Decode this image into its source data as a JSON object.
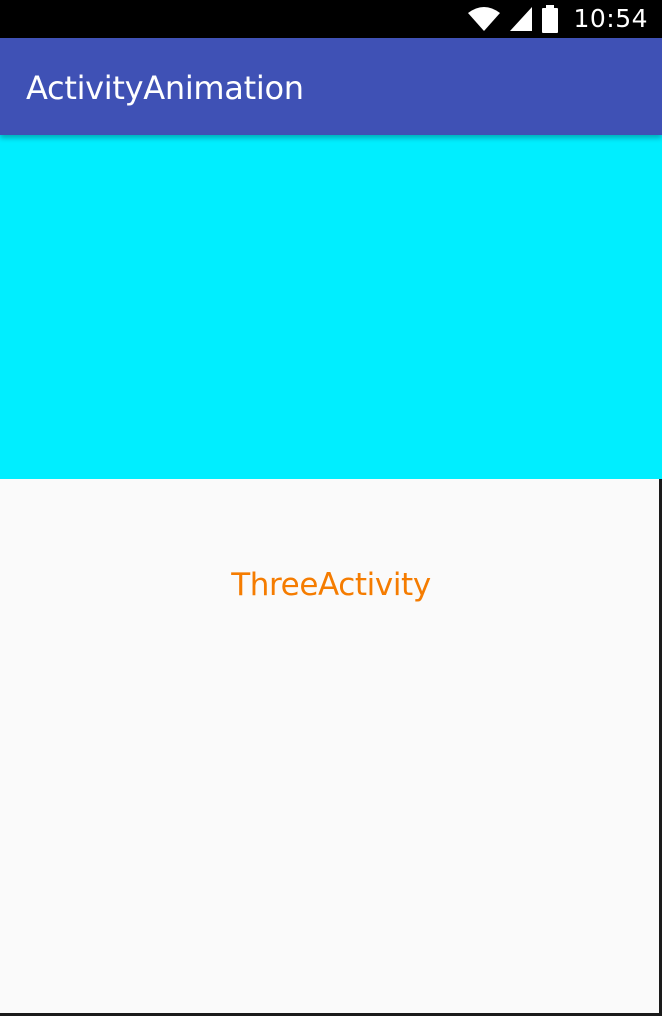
{
  "status_bar": {
    "time": "10:54",
    "icons": [
      "wifi-icon",
      "cell-signal-icon",
      "battery-icon"
    ]
  },
  "app_bar": {
    "title": "ActivityAnimation",
    "color": "#3f51b5"
  },
  "header_block": {
    "color": "#00eeff"
  },
  "content": {
    "label": "ThreeActivity",
    "label_color": "#f57c00"
  }
}
